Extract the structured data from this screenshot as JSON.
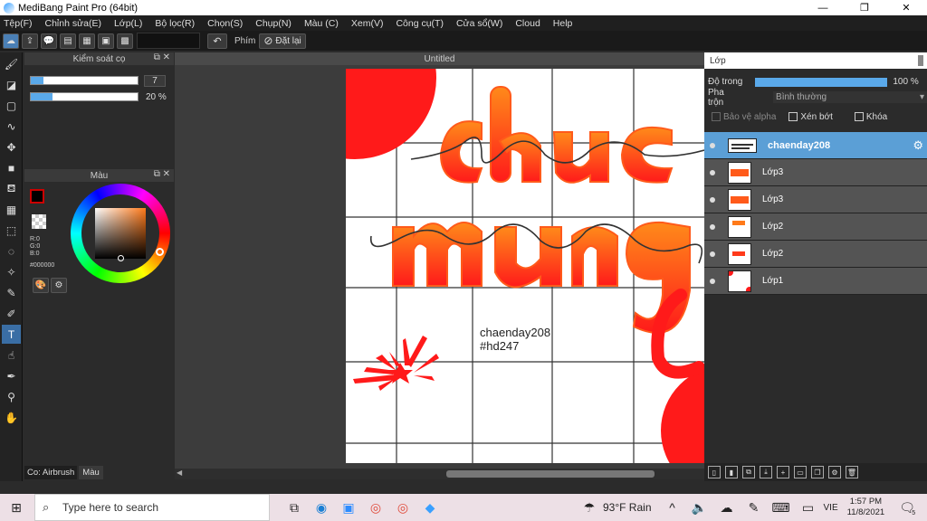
{
  "window": {
    "title": "MediBang Paint Pro (64bit)",
    "minimize": "—",
    "maximize": "❐",
    "close": "✕"
  },
  "menu": [
    "Tệp(F)",
    "Chỉnh sửa(E)",
    "Lớp(L)",
    "Bộ lọc(R)",
    "Chọn(S)",
    "Chụp(N)",
    "Màu (C)",
    "Xem(V)",
    "Công cụ(T)",
    "Cửa sổ(W)",
    "Cloud",
    "Help"
  ],
  "toolbar": {
    "snap_label": "Phím",
    "reset_label": "Đặt lại"
  },
  "brush_panel": {
    "title": "Kiểm soát cọ",
    "size_value": "7",
    "opacity_value": "20 %",
    "size_fraction": 0.12,
    "opacity_fraction": 0.2
  },
  "color_panel": {
    "title": "Màu",
    "r": "R:0",
    "g": "G:0",
    "b": "B:0",
    "hex": "#000000"
  },
  "canvas": {
    "title": "Untitled",
    "text_line1": "chaenday208",
    "text_line2": "#hd247"
  },
  "layers_panel": {
    "title": "Lớp",
    "opacity_label": "Độ trong",
    "opacity_value": "100 %",
    "opacity_fraction": 1.0,
    "blend_label": "Pha trộn",
    "blend_value": "Bình thường",
    "protect_alpha": "Bảo vệ alpha",
    "clipping": "Xén bớt",
    "lock": "Khóa",
    "layers": [
      {
        "name": "chaenday208",
        "selected": true
      },
      {
        "name": "Lớp3",
        "selected": false
      },
      {
        "name": "Lớp3",
        "selected": false
      },
      {
        "name": "Lớp2",
        "selected": false
      },
      {
        "name": "Lớp2",
        "selected": false
      },
      {
        "name": "Lớp1",
        "selected": false
      }
    ]
  },
  "status_tabs": {
    "brush": "Co: Airbrush",
    "color": "Màu"
  },
  "taskbar": {
    "search_placeholder": "Type here to search",
    "weather": "93°F  Rain",
    "lang": "VIE",
    "time": "1:57 PM",
    "date": "11/8/2021",
    "notifications": "5"
  },
  "colors": {
    "accent": "#5b9fd6",
    "art_red": "#ff1a1a",
    "art_orange": "#ff7a1a",
    "taskbar": "#ede0e6"
  }
}
